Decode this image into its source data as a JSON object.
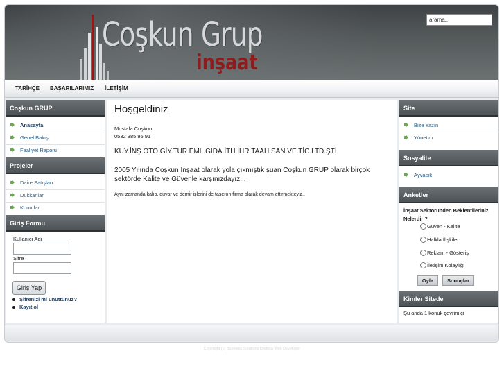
{
  "header": {
    "logo_title": "Coşkun Grup",
    "logo_subtitle": "inşaat",
    "search_placeholder": "arama..."
  },
  "nav": {
    "items": [
      "TARİHÇE",
      "BAŞARILARIMIZ",
      "İLETİŞİM"
    ]
  },
  "left_sidebar": {
    "modules": [
      {
        "title": "Coşkun GRUP",
        "items": [
          "Anasayfa",
          "Genel Bakış",
          "Faaliyet Raporu"
        ],
        "active_index": 0
      },
      {
        "title": "Projeler",
        "items": [
          "Daire Satışları",
          "Dükkanlar",
          "Konutlar"
        ]
      }
    ],
    "login": {
      "title": "Giriş Formu",
      "username_label": "Kullanıcı Adı",
      "password_label": "Şifre",
      "submit_label": "Giriş Yap",
      "links": [
        "Şifrenizi mi unuttunuz?",
        "Kayıt ol"
      ]
    }
  },
  "main": {
    "title": "Hoşgeldiniz",
    "contact_name": "Mustafa Coşkun",
    "contact_phone": "0532 385 95 91",
    "company": "KUY.İNŞ.OTO.GİY.TUR.EML.GIDA.İTH.İHR.TAAH.SAN.VE TİC.LTD.ŞTİ",
    "intro": "2005 Yılında Coşkun İnşaat olarak yola çıkmıştık şuan Coşkun GRUP olarak birçok sektörde Kalite ve Güvenle karşınızdayız...",
    "note": "Aynı zamanda kalıp, duvar ve demir işlerini de taşeron firma olarak devam ettirmekteyiz.."
  },
  "right_sidebar": {
    "site": {
      "title": "Site",
      "items": [
        "Bize Yazın",
        "Yönetim"
      ]
    },
    "social": {
      "title": "Sosyalite",
      "items": [
        "Ayvacık"
      ]
    },
    "poll": {
      "title": "Anketler",
      "question": "İnşaat Sektöründen Beklentileriniz Nelerdir ?",
      "options": [
        "Güven - Kalite",
        "Halkla İlişkiler",
        "Reklam - Gösteriş",
        "İletişim Kolaylığı"
      ],
      "vote_label": "Oyla",
      "results_label": "Sonuçlar"
    },
    "online": {
      "title": "Kimler Sitede",
      "text": "Şu anda 1 konuk çevrimiçi"
    }
  },
  "footer": {
    "copyright": "Copyright (c) Business Solutions Dodeca Web Developer"
  },
  "colors": {
    "header_dark": "#3e4244",
    "module_head": "#4d5356",
    "logo_red": "#8e1c1c",
    "link_blue": "#2a5e86",
    "arrow_green": "#6aa84f"
  }
}
